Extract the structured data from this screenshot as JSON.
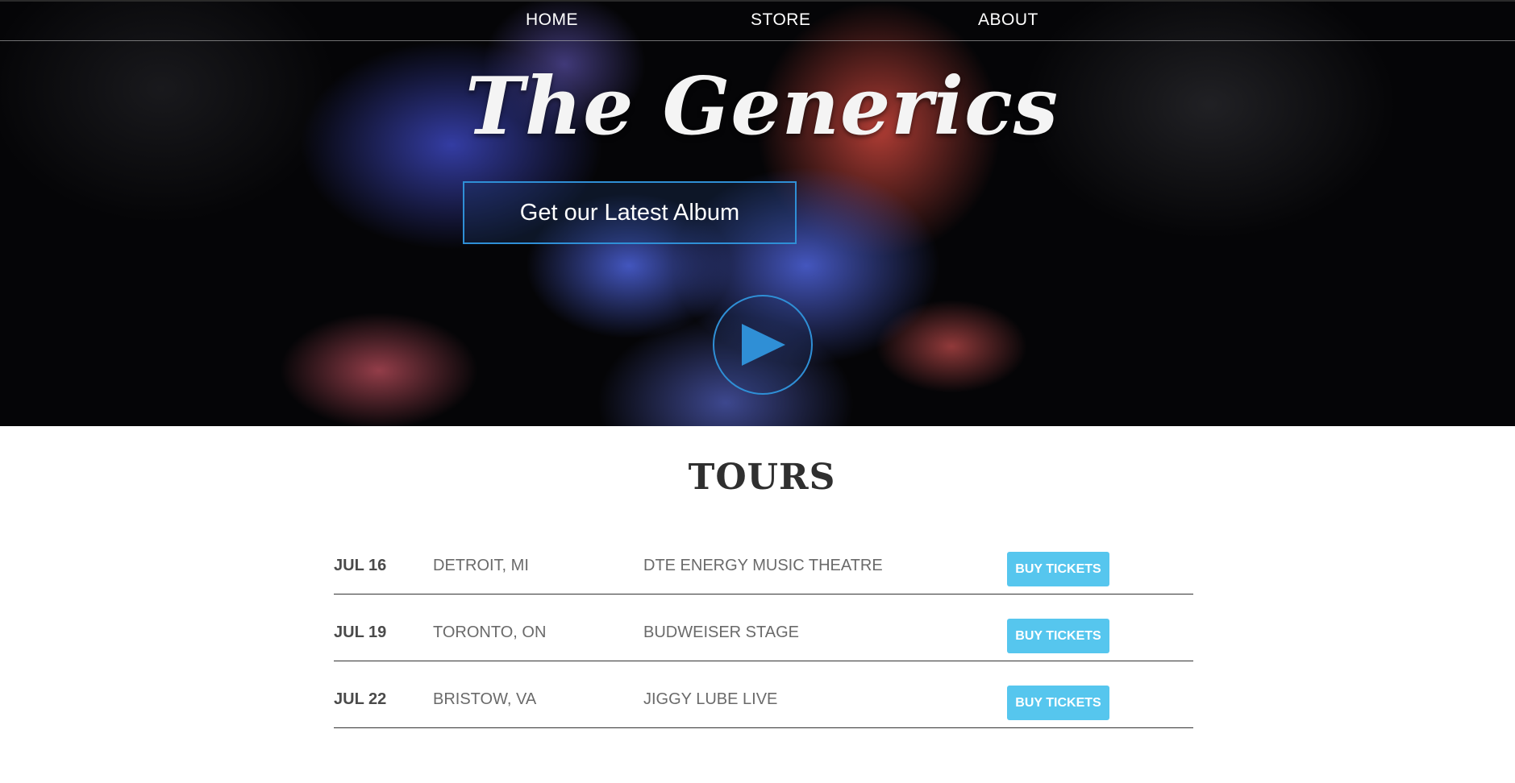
{
  "nav": {
    "links": [
      {
        "label": "HOME"
      },
      {
        "label": "STORE"
      },
      {
        "label": "ABOUT"
      }
    ]
  },
  "hero": {
    "title": "The Generics",
    "album_button": "Get our Latest Album",
    "play_icon": "play-icon"
  },
  "tours": {
    "title": "TOURS",
    "rows": [
      {
        "date": "JUL 16",
        "city": "DETROIT, MI",
        "venue": "DTE ENERGY MUSIC THEATRE",
        "button": "BUY TICKETS"
      },
      {
        "date": "JUL 19",
        "city": "TORONTO, ON",
        "venue": "BUDWEISER STAGE",
        "button": "BUY TICKETS"
      },
      {
        "date": "JUL 22",
        "city": "BRISTOW, VA",
        "venue": "JIGGY LUBE LIVE",
        "button": "BUY TICKETS"
      }
    ]
  },
  "colors": {
    "accent": "#2f8fd6",
    "button": "#56c6ee",
    "heading": "#2f2f2f"
  }
}
